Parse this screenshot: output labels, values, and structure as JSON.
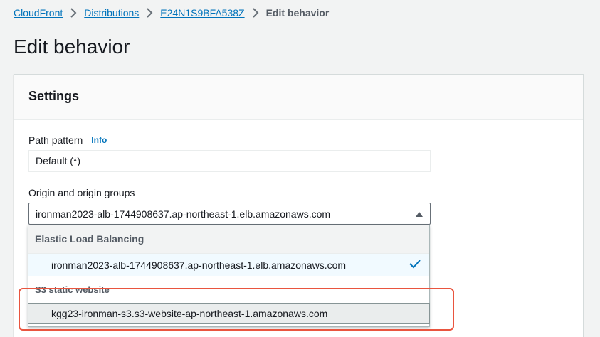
{
  "breadcrumb": {
    "items": [
      "CloudFront",
      "Distributions",
      "E24N1S9BFA538Z"
    ],
    "current": "Edit behavior"
  },
  "page": {
    "title": "Edit behavior"
  },
  "settings": {
    "header": "Settings",
    "path_pattern": {
      "label": "Path pattern",
      "info": "Info",
      "value": "Default (*)"
    },
    "origin": {
      "label": "Origin and origin groups",
      "selected": "ironman2023-alb-1744908637.ap-northeast-1.elb.amazonaws.com"
    }
  },
  "dropdown": {
    "groups": [
      {
        "label": "Elastic Load Balancing",
        "options": [
          "ironman2023-alb-1744908637.ap-northeast-1.elb.amazonaws.com"
        ]
      },
      {
        "label": "S3 static website",
        "options": [
          "kgg23-ironman-s3.s3-website-ap-northeast-1.amazonaws.com"
        ]
      }
    ]
  },
  "colors": {
    "link": "#0073bb",
    "highlight": "#e9553f",
    "check": "#0073bb"
  }
}
